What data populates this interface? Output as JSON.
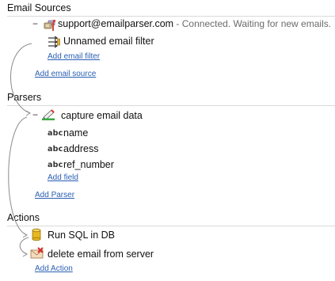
{
  "email_sources": {
    "title": "Email Sources",
    "account": {
      "collapse_symbol": "−",
      "address": "support@emailparser.com",
      "status": " - Connected. Waiting for new emails."
    },
    "filter": {
      "label": "Unnamed email filter"
    },
    "add_filter_link": "Add email filter",
    "add_source_link": "Add email source"
  },
  "parsers": {
    "title": "Parsers",
    "parser": {
      "collapse_symbol": "−",
      "label": "capture email data"
    },
    "fields": [
      {
        "type_badge": "abc",
        "name": "name"
      },
      {
        "type_badge": "abc",
        "name": "address"
      },
      {
        "type_badge": "abc",
        "name": "ref_number"
      }
    ],
    "add_field_link": "Add field",
    "add_parser_link": "Add Parser"
  },
  "actions": {
    "title": "Actions",
    "items": [
      {
        "label": "Run SQL in DB",
        "icon": "database-icon"
      },
      {
        "label": "delete email from server",
        "icon": "delete-email-icon"
      }
    ],
    "add_action_link": "Add Action"
  },
  "colors": {
    "link": "#2a5fb3",
    "section_line": "#d9d9d9",
    "status_text": "#6b6b6b",
    "connector": "#8a8a8a"
  }
}
